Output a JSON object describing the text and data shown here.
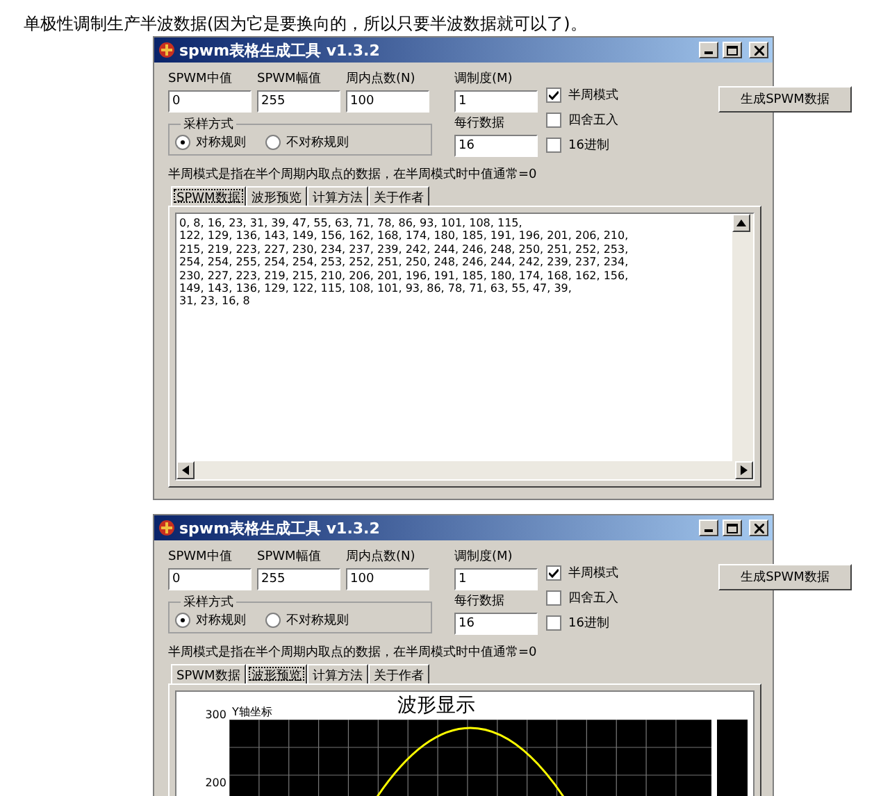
{
  "caption": "单极性调制生产半波数据(因为它是要换向的，所以只要半波数据就可以了)。",
  "windows": [
    {
      "title": "spwm表格生成工具 v1.3.2",
      "fields": [
        {
          "label": "SPWM中值",
          "value": "0"
        },
        {
          "label": "SPWM幅值",
          "value": "255"
        },
        {
          "label": "周内点数(N)",
          "value": "100"
        }
      ],
      "sampling": {
        "label": "采样方式",
        "options": [
          {
            "label": "对称规则",
            "selected": true
          },
          {
            "label": "不对称规则",
            "selected": false
          }
        ]
      },
      "modulation": {
        "label": "调制度(M)",
        "value": "1"
      },
      "per_row": {
        "label": "每行数据",
        "value": "16"
      },
      "checkboxes": [
        {
          "label": "半周模式",
          "checked": true
        },
        {
          "label": "四舍五入",
          "checked": false
        },
        {
          "label": "16进制",
          "checked": false
        }
      ],
      "generate_button": "生成SPWM数据",
      "note": "半周模式是指在半个周期内取点的数据，在半周模式时中值通常=0",
      "tabs": [
        {
          "label": "SPWM数据",
          "selected": true
        },
        {
          "label": "波形预览",
          "selected": false
        },
        {
          "label": "计算方法",
          "selected": false
        },
        {
          "label": "关于作者",
          "selected": false
        }
      ],
      "content": {
        "kind": "text",
        "lines": [
          "0, 8, 16, 23, 31, 39, 47, 55, 63, 71, 78, 86, 93, 101, 108, 115,",
          "122, 129, 136, 143, 149, 156, 162, 168, 174, 180, 185, 191, 196, 201, 206, 210,",
          "215, 219, 223, 227, 230, 234, 237, 239, 242, 244, 246, 248, 250, 251, 252, 253,",
          "254, 254, 255, 254, 254, 253, 252, 251, 250, 248, 246, 244, 242, 239, 237, 234,",
          "230, 227, 223, 219, 215, 210, 206, 201, 196, 191, 185, 180, 174, 168, 162, 156,",
          "149, 143, 136, 129, 122, 115, 108, 101, 93, 86, 78, 71, 63, 55, 47, 39,",
          "31, 23, 16, 8"
        ]
      }
    },
    {
      "title": "spwm表格生成工具 v1.3.2",
      "fields": [
        {
          "label": "SPWM中值",
          "value": "0"
        },
        {
          "label": "SPWM幅值",
          "value": "255"
        },
        {
          "label": "周内点数(N)",
          "value": "100"
        }
      ],
      "sampling": {
        "label": "采样方式",
        "options": [
          {
            "label": "对称规则",
            "selected": true
          },
          {
            "label": "不对称规则",
            "selected": false
          }
        ]
      },
      "modulation": {
        "label": "调制度(M)",
        "value": "1"
      },
      "per_row": {
        "label": "每行数据",
        "value": "16"
      },
      "checkboxes": [
        {
          "label": "半周模式",
          "checked": true
        },
        {
          "label": "四舍五入",
          "checked": false
        },
        {
          "label": "16进制",
          "checked": false
        }
      ],
      "generate_button": "生成SPWM数据",
      "note": "半周模式是指在半个周期内取点的数据，在半周模式时中值通常=0",
      "tabs": [
        {
          "label": "SPWM数据",
          "selected": false
        },
        {
          "label": "波形预览",
          "selected": true
        },
        {
          "label": "计算方法",
          "selected": false
        },
        {
          "label": "关于作者",
          "selected": false
        }
      ],
      "content": {
        "kind": "chart",
        "title": "波形显示",
        "ylabel": "Y轴坐标",
        "tick_labels": [
          "300",
          "200"
        ]
      }
    }
  ]
}
